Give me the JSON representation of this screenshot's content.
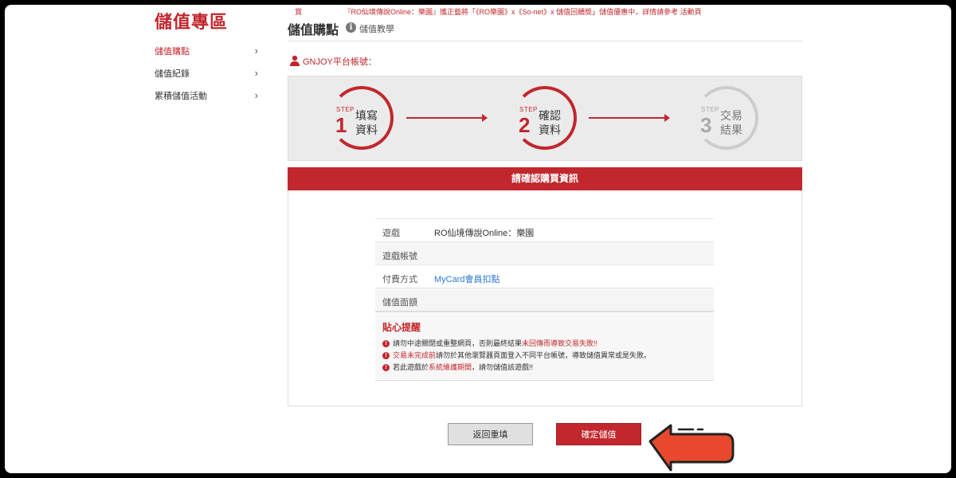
{
  "notice": {
    "lead": "賞",
    "text": "『RO仙境傳說Online：樂園』攜正藝將「《RO樂園》x《So-net》x 儲值回饋獎」儲值優惠中，詳情請參考 活動頁"
  },
  "sidebar": {
    "title": "儲值專區",
    "items": [
      {
        "label": "儲值購點"
      },
      {
        "label": "儲值紀錄"
      },
      {
        "label": "累積儲值活動"
      }
    ]
  },
  "header": {
    "title": "儲值購點",
    "tutorial_link": "儲值教學",
    "account_label": "GNJOY平台帳號："
  },
  "steps": [
    {
      "label": "STEP",
      "num": "1",
      "line1": "填寫",
      "line2": "資料"
    },
    {
      "label": "STEP",
      "num": "2",
      "line1": "確認",
      "line2": "資料"
    },
    {
      "label": "STEP",
      "num": "3",
      "line1": "交易",
      "line2": "結果"
    }
  ],
  "confirm": {
    "header": "請確認購買資訊",
    "rows": [
      {
        "key": "遊戲",
        "value": "RO仙境傳說Online：樂園"
      },
      {
        "key": "遊戲帳號",
        "value": ""
      },
      {
        "key": "付費方式",
        "value": "MyCard會員扣點"
      },
      {
        "key": "儲值面額",
        "value": ""
      }
    ],
    "reminder_title": "貼心提醒",
    "notes": [
      {
        "before": "請勿中途關閉或重整網頁，否則最終結果",
        "highlight": "未回傳而導致交易失敗!!",
        "after": ""
      },
      {
        "before": "",
        "highlight": "交易未完成前",
        "after": "請勿於其他瀏覽器頁面登入不同平台帳號，導致儲值異常或是失敗。"
      },
      {
        "before": "若此遊戲於",
        "highlight": "系統維護期間",
        "after": "，請勿儲值該遊戲!!"
      }
    ]
  },
  "buttons": {
    "back": "返回重填",
    "confirm": "確定儲值"
  },
  "colors": {
    "accent": "#c1272d",
    "link": "#2a7bd4"
  }
}
